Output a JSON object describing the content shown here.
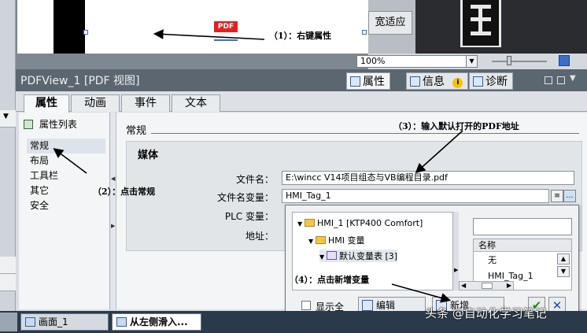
{
  "canvas": {
    "pdf_marker_label": "PDF",
    "fit_button_label": "宽适应",
    "zoom_value": "100%"
  },
  "inspector": {
    "title": "PDFView_1 [PDF 视图]",
    "tabs": [
      {
        "label": "属性"
      },
      {
        "label": "信息"
      },
      {
        "label": "诊断"
      }
    ],
    "info_badge": "i"
  },
  "subtabs": [
    {
      "label": "属性"
    },
    {
      "label": "动画"
    },
    {
      "label": "事件"
    },
    {
      "label": "文本"
    }
  ],
  "nav": {
    "header": "属性列表",
    "items": [
      {
        "label": "常规"
      },
      {
        "label": "布局"
      },
      {
        "label": "工具栏"
      },
      {
        "label": "其它"
      },
      {
        "label": "安全"
      }
    ]
  },
  "content": {
    "section_title": "常规",
    "group_title": "媒体",
    "fields": {
      "filename_label": "文件名：",
      "filename_value": "E:\\wincc V14项目组态与VB编程目录.pdf",
      "filename_tag_label": "文件名变量：",
      "filename_tag_value": "HMI_Tag_1",
      "plc_tag_label": "PLC 变量：",
      "address_label": "地址："
    }
  },
  "popup": {
    "tree": [
      {
        "label": "HMI_1 [KTP400 Comfort]"
      },
      {
        "label": "HMI 变量"
      },
      {
        "label": "默认变量表 [3]"
      }
    ],
    "list_header": "名称",
    "list_rows": [
      {
        "label": "无"
      },
      {
        "label": "HMI_Tag_1"
      }
    ],
    "show_all_label": "显示全",
    "edit_label": "编辑",
    "add_label": "新增",
    "ok_symbol": "✔",
    "cancel_symbol": "✕"
  },
  "annotations": {
    "step1": "（1）：右键属性",
    "step2": "（2）：点击常规",
    "step3": "（3）：输入默认打开的PDF地址",
    "step4": "（4）：点击新增变量"
  },
  "taskbar": {
    "items": [
      {
        "label": "画面_1"
      },
      {
        "label": "从左侧滑入..."
      }
    ]
  },
  "watermark": "头条 @自动化学习笔记"
}
